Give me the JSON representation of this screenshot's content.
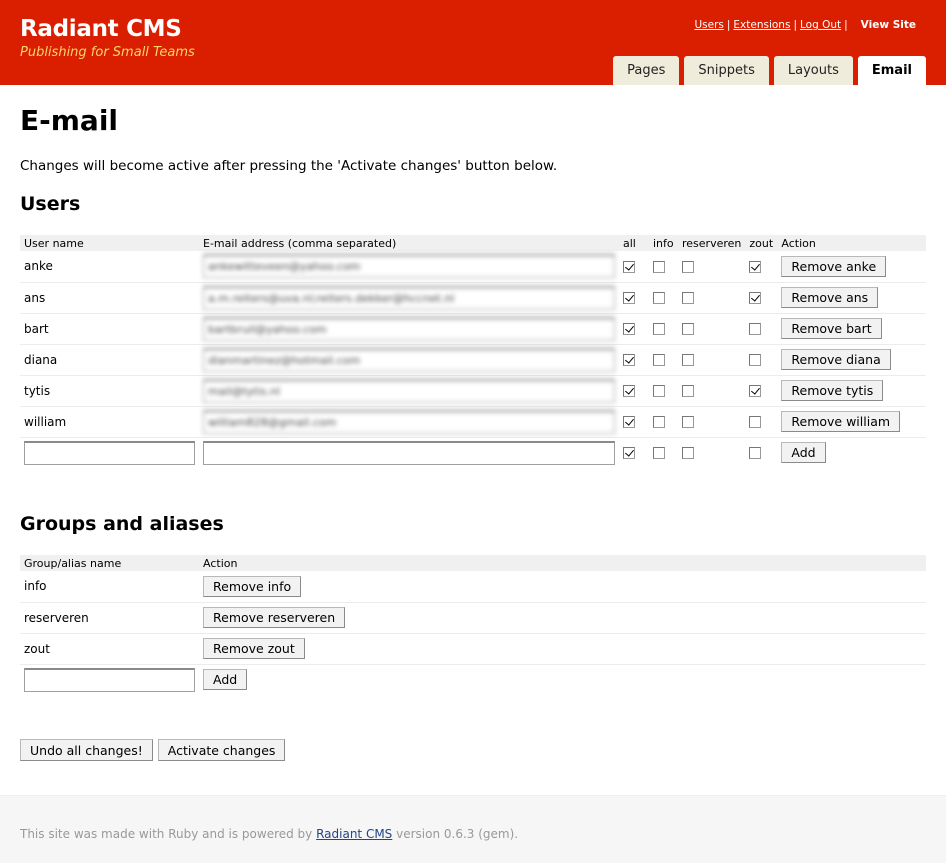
{
  "header": {
    "title": "Radiant CMS",
    "subtitle": "Publishing for Small Teams",
    "nav": {
      "users": "Users",
      "extensions": "Extensions",
      "logout": "Log Out",
      "sep": "|",
      "view_site": "View Site"
    },
    "tabs": [
      "Pages",
      "Snippets",
      "Layouts",
      "Email"
    ],
    "active_tab": "Email"
  },
  "colors": {
    "header_bg": "#d91f00",
    "subtitle": "#ffd36a",
    "tab_bg": "#f0ecdc"
  },
  "page_title": "E-mail",
  "intro": "Changes will become active after pressing the 'Activate changes' button below.",
  "users": {
    "title": "Users",
    "headers": {
      "name": "User name",
      "email": "E-mail address (comma separated)",
      "all": "all",
      "info": "info",
      "reserveren": "reserveren",
      "zout": "zout",
      "action": "Action"
    },
    "rows": [
      {
        "name": "anke",
        "email": "ankewitteveen@yahoo.com",
        "all": true,
        "info": false,
        "reserveren": false,
        "zout": true,
        "remove": "Remove anke"
      },
      {
        "name": "ans",
        "email": "a.m.reiters@uva.nl;reiters.dekker@hccnet.nl",
        "all": true,
        "info": false,
        "reserveren": false,
        "zout": true,
        "remove": "Remove ans"
      },
      {
        "name": "bart",
        "email": "bartbruil@yahoo.com",
        "all": true,
        "info": false,
        "reserveren": false,
        "zout": false,
        "remove": "Remove bart"
      },
      {
        "name": "diana",
        "email": "dianmartinez@hotmail.com",
        "all": true,
        "info": false,
        "reserveren": false,
        "zout": false,
        "remove": "Remove diana"
      },
      {
        "name": "tytis",
        "email": "mail@tytis.nl",
        "all": true,
        "info": false,
        "reserveren": false,
        "zout": true,
        "remove": "Remove tytis"
      },
      {
        "name": "william",
        "email": "william828@gmail.com",
        "all": true,
        "info": false,
        "reserveren": false,
        "zout": false,
        "remove": "Remove william"
      }
    ],
    "new_row": {
      "name": "",
      "email": "",
      "all": true,
      "info": false,
      "reserveren": false,
      "zout": false,
      "add": "Add"
    }
  },
  "groups": {
    "title": "Groups and aliases",
    "headers": {
      "name": "Group/alias name",
      "action": "Action"
    },
    "rows": [
      {
        "name": "info",
        "remove": "Remove info"
      },
      {
        "name": "reserveren",
        "remove": "Remove reserveren"
      },
      {
        "name": "zout",
        "remove": "Remove zout"
      }
    ],
    "new_row": {
      "name": "",
      "add": "Add"
    }
  },
  "buttons": {
    "undo": "Undo all changes!",
    "activate": "Activate changes"
  },
  "footer": {
    "before": "This site was made with Ruby and is powered by ",
    "link": "Radiant CMS",
    "after": " version 0.6.3 (gem)."
  }
}
